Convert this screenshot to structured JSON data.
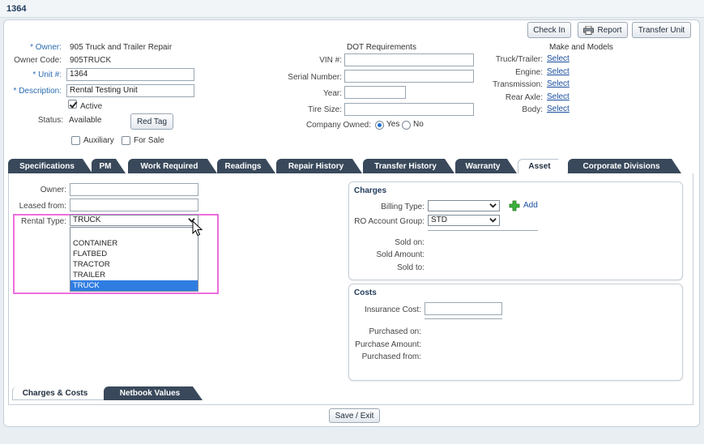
{
  "window": {
    "title": "1364"
  },
  "toolbar": {
    "check_in": "Check In",
    "report": "Report",
    "transfer_unit": "Transfer Unit"
  },
  "unit": {
    "owner_label": "* Owner:",
    "owner_value": "905 Truck and Trailer Repair",
    "owner_code_label": "Owner Code:",
    "owner_code_value": "905TRUCK",
    "unit_label": "* Unit #:",
    "unit_value": "1364",
    "description_label": "* Description:",
    "description_value": "Rental Testing Unit",
    "active_label": "Active",
    "status_label": "Status:",
    "status_value": "Available",
    "red_tag_label": "Red Tag",
    "auxiliary_label": "Auxiliary",
    "for_sale_label": "For Sale"
  },
  "dot": {
    "heading": "DOT Requirements",
    "vin_label": "VIN #:",
    "vin_value": "",
    "serial_label": "Serial Number:",
    "serial_value": "",
    "year_label": "Year:",
    "year_value": "",
    "tire_label": "Tire Size:",
    "tire_value": "",
    "company_owned_label": "Company Owned:",
    "yes_label": "Yes",
    "no_label": "No"
  },
  "make_models": {
    "heading": "Make and Models",
    "rows": [
      {
        "label": "Truck/Trailer:",
        "link": "Select"
      },
      {
        "label": "Engine:",
        "link": "Select"
      },
      {
        "label": "Transmission:",
        "link": "Select"
      },
      {
        "label": "Rear Axle:",
        "link": "Select"
      },
      {
        "label": "Body:",
        "link": "Select"
      }
    ]
  },
  "tabs": [
    "Specifications",
    "PM",
    "Work Required",
    "Readings",
    "Repair History",
    "Transfer History",
    "Warranty",
    "Asset",
    "Corporate Divisions"
  ],
  "asset": {
    "owner_label": "Owner:",
    "owner_value": "",
    "leased_label": "Leased from:",
    "leased_value": "",
    "rental_label": "Rental Type:",
    "rental_value": "TRUCK",
    "rental_options": [
      "",
      "CONTAINER",
      "FLATBED",
      "TRACTOR",
      "TRAILER",
      "TRUCK"
    ]
  },
  "charges": {
    "title": "Charges",
    "billing_label": "Billing Type:",
    "billing_value": "",
    "add_label": "Add",
    "ro_label": "RO Account Group:",
    "ro_value": "STD",
    "sold_on_label": "Sold on:",
    "sold_amount_label": "Sold Amount:",
    "sold_to_label": "Sold to:"
  },
  "costs": {
    "title": "Costs",
    "insurance_label": "Insurance Cost:",
    "insurance_value": "",
    "purchased_on_label": "Purchased on:",
    "purchase_amount_label": "Purchase Amount:",
    "purchased_from_label": "Purchased from:"
  },
  "bottom_tabs": [
    "Charges & Costs",
    "Netbook Values"
  ],
  "footer": {
    "save_exit": "Save / Exit"
  },
  "colors": {
    "tab_dark": "#39495b",
    "accent": "#2f7de1",
    "highlight": "#f06ddc",
    "link": "#1a4fa0"
  }
}
